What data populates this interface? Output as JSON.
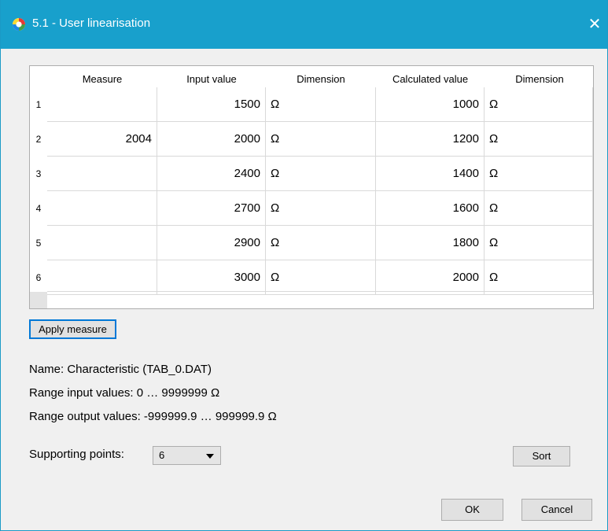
{
  "window": {
    "title": "5.1 - User linearisation",
    "close_glyph": "✕"
  },
  "grid": {
    "columns": [
      "Measure",
      "Input value",
      "Dimension",
      "Calculated value",
      "Dimension"
    ],
    "rows": [
      {
        "index": "1",
        "measure": "",
        "input": "1500",
        "input_dim": "Ω",
        "calc": "1000",
        "calc_dim": "Ω"
      },
      {
        "index": "2",
        "measure": "2004",
        "input": "2000",
        "input_dim": "Ω",
        "calc": "1200",
        "calc_dim": "Ω"
      },
      {
        "index": "3",
        "measure": "",
        "input": "2400",
        "input_dim": "Ω",
        "calc": "1400",
        "calc_dim": "Ω"
      },
      {
        "index": "4",
        "measure": "",
        "input": "2700",
        "input_dim": "Ω",
        "calc": "1600",
        "calc_dim": "Ω"
      },
      {
        "index": "5",
        "measure": "",
        "input": "2900",
        "input_dim": "Ω",
        "calc": "1800",
        "calc_dim": "Ω"
      },
      {
        "index": "6",
        "measure": "",
        "input": "3000",
        "input_dim": "Ω",
        "calc": "2000",
        "calc_dim": "Ω"
      }
    ]
  },
  "buttons": {
    "apply_measure": "Apply measure",
    "sort": "Sort",
    "ok": "OK",
    "cancel": "Cancel"
  },
  "info": {
    "name": "Name: Characteristic (TAB_0.DAT)",
    "range_input": "Range input values: 0 … 9999999 Ω",
    "range_output": "Range output values: -999999.9 … 999999.9 Ω"
  },
  "supporting_points": {
    "label": "Supporting points:",
    "value": "6"
  },
  "icons": {
    "app": "app-logo-icon",
    "close": "close-icon",
    "dropdown": "chevron-down-icon"
  },
  "colors": {
    "titlebar": "#18a0cc",
    "default_button_border": "#0078d7"
  }
}
